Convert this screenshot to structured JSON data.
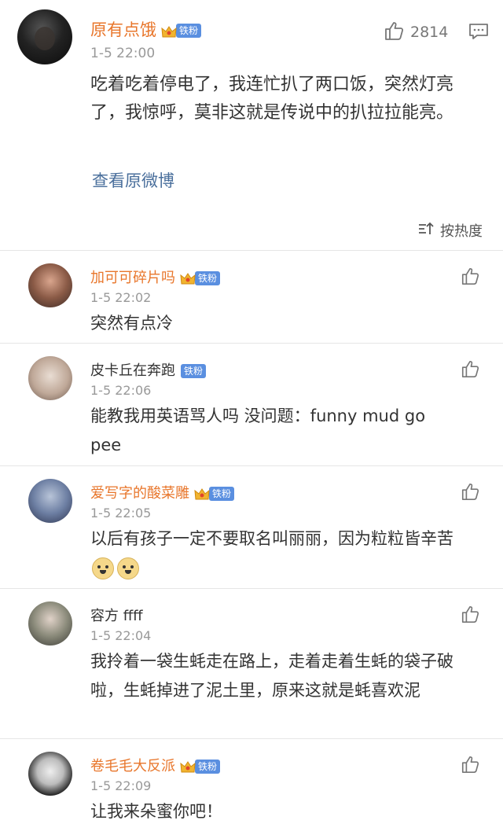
{
  "post": {
    "name": "原有点饿",
    "badge": "铁粉",
    "time": "1-5 22:00",
    "text": "吃着吃着停电了，我连忙扒了两口饭，突然灯亮了，我惊呼，莫非这就是传说中的扒拉拉能亮。",
    "link": "查看原微博",
    "likes": "2814"
  },
  "sort": {
    "label": "按热度"
  },
  "comments": [
    {
      "name": "加可可碎片吗",
      "badge": "铁粉",
      "time": "1-5 22:02",
      "text": "突然有点冷"
    },
    {
      "name": "皮卡丘在奔跑",
      "badge": "铁粉",
      "time": "1-5 22:06",
      "text": "能教我用英语骂人吗  没问题：funny mud go pee"
    },
    {
      "name": "爱写字的酸菜雕",
      "badge": "铁粉",
      "time": "1-5 22:05",
      "text": "以后有孩子一定不要取名叫丽丽，因为粒粒皆辛苦"
    },
    {
      "name": "容方 ffff",
      "time": "1-5 22:04",
      "text": "我拎着一袋生蚝走在路上，走着走着生蚝的袋子破啦，生蚝掉进了泥土里，原来这就是蚝喜欢泥"
    },
    {
      "name": "卷毛毛大反派",
      "badge": "铁粉",
      "time": "1-5 22:09",
      "text": "让我来朵蜜你吧！"
    }
  ]
}
